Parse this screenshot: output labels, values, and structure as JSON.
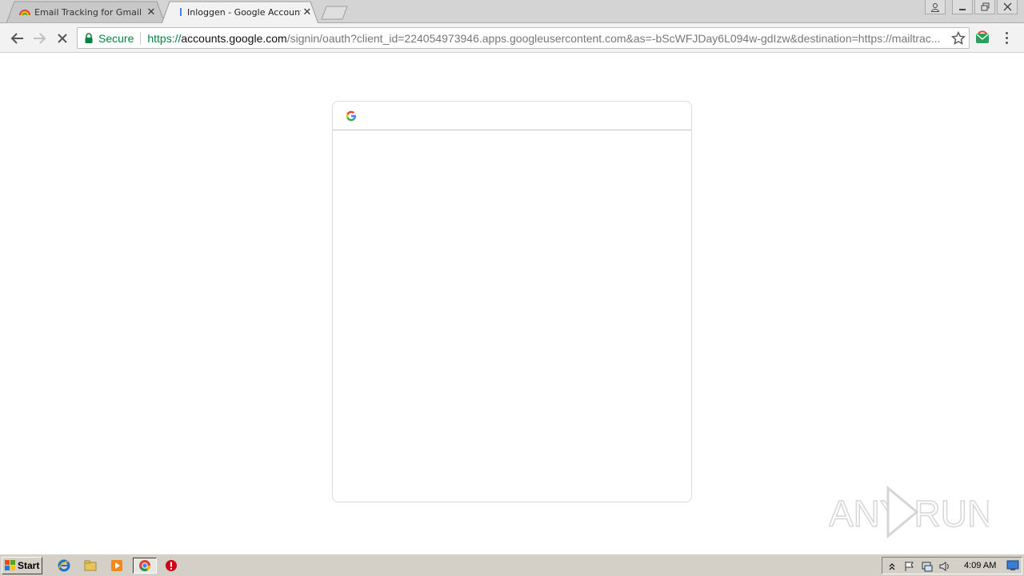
{
  "browser": {
    "tabs": [
      {
        "title": "Email Tracking for Gmail - Ma",
        "favicon": "rainbow-icon",
        "active": false
      },
      {
        "title": "Inloggen - Google Accounts",
        "favicon": "loading-icon",
        "active": true
      }
    ],
    "omnibox": {
      "security_label": "Secure",
      "url_scheme": "https://",
      "url_host": "accounts.google.com",
      "url_rest": "/signin/oauth?client_id=224054973946.apps.googleusercontent.com&as=-bScWFJDay6L094w-gdIzw&destination=https://mailtrac..."
    }
  },
  "page": {
    "logo": "google-g-icon"
  },
  "watermark": {
    "text": "ANY RUN"
  },
  "taskbar": {
    "start_label": "Start",
    "clock": "4:09 AM"
  },
  "colors": {
    "secure_green": "#0b8043",
    "google_blue": "#4285f4",
    "google_red": "#ea4335",
    "google_yellow": "#fbbc05",
    "google_green": "#34a853"
  }
}
